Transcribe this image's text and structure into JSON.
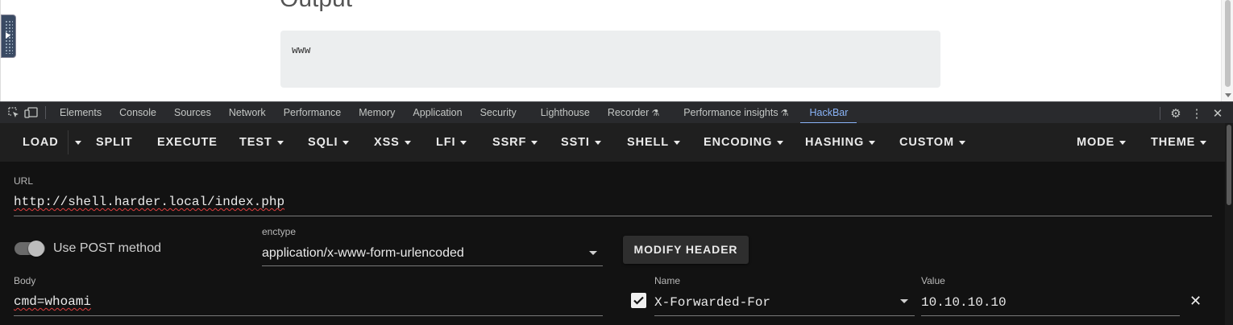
{
  "page": {
    "heading": "Output",
    "output_text": "www"
  },
  "devtools": {
    "tabs": [
      "Elements",
      "Console",
      "Sources",
      "Network",
      "Performance",
      "Memory",
      "Application",
      "Security",
      "Lighthouse",
      "Recorder",
      "Performance insights",
      "HackBar"
    ],
    "active_tab": "HackBar"
  },
  "hackbar": {
    "toolbar": {
      "load": "LOAD",
      "split": "SPLIT",
      "execute": "EXECUTE",
      "test": "TEST",
      "sqli": "SQLI",
      "xss": "XSS",
      "lfi": "LFI",
      "ssrf": "SSRF",
      "ssti": "SSTI",
      "shell": "SHELL",
      "encoding": "ENCODING",
      "hashing": "HASHING",
      "custom": "CUSTOM",
      "mode": "MODE",
      "theme": "THEME"
    },
    "url_label": "URL",
    "url_value": "http://shell.harder.local/index.php",
    "post_label": "Use POST method",
    "post_enabled": true,
    "enctype_label": "enctype",
    "enctype_value": "application/x-www-form-urlencoded",
    "modify_header_label": "MODIFY HEADER",
    "body_label": "Body",
    "body_value": "cmd=whoami",
    "header": {
      "enabled": true,
      "name_label": "Name",
      "name_value": "X-Forwarded-For",
      "value_label": "Value",
      "value_value": "10.10.10.10"
    }
  }
}
